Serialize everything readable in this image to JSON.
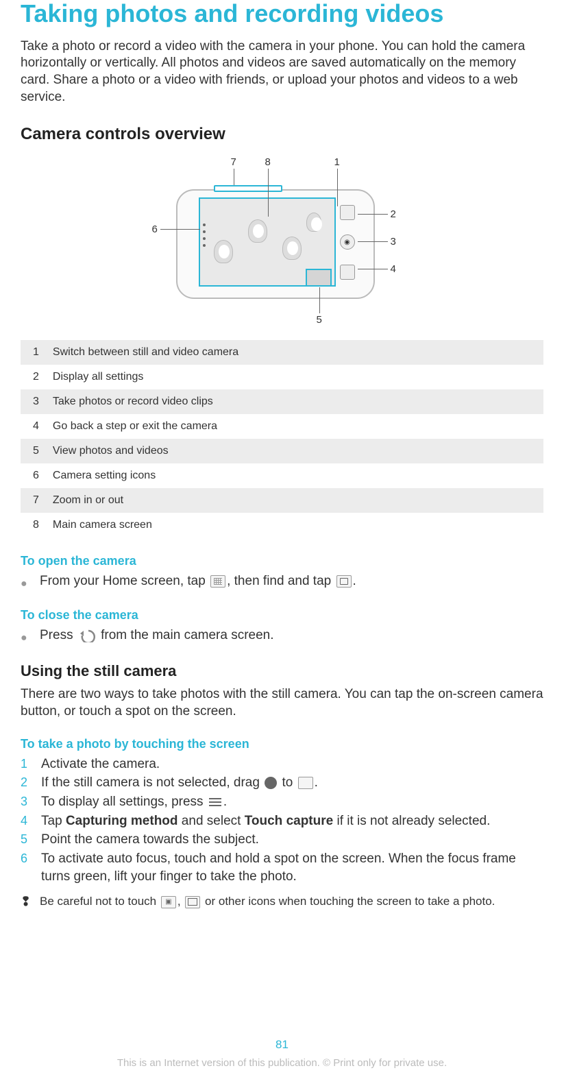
{
  "title": "Taking photos and recording videos",
  "intro": "Take a photo or record a video with the camera in your phone. You can hold the camera horizontally or vertically. All photos and videos are saved automatically on the memory card. Share a photo or a video with friends, or upload your photos and videos to a web service.",
  "section_controls": "Camera controls overview",
  "callouts": {
    "c1": "1",
    "c2": "2",
    "c3": "3",
    "c4": "4",
    "c5": "5",
    "c6": "6",
    "c7": "7",
    "c8": "8"
  },
  "legend": [
    {
      "n": "1",
      "t": "Switch between still and video camera"
    },
    {
      "n": "2",
      "t": "Display all settings"
    },
    {
      "n": "3",
      "t": "Take photos or record video clips"
    },
    {
      "n": "4",
      "t": "Go back a step or exit the camera"
    },
    {
      "n": "5",
      "t": "View photos and videos"
    },
    {
      "n": "6",
      "t": "Camera setting icons"
    },
    {
      "n": "7",
      "t": "Zoom in or out"
    },
    {
      "n": "8",
      "t": "Main camera screen"
    }
  ],
  "open_heading": "To open the camera",
  "open_step_pre": "From your Home screen, tap ",
  "open_step_mid": ", then find and tap ",
  "open_step_post": ".",
  "close_heading": "To close the camera",
  "close_step_pre": "Press ",
  "close_step_post": " from the main camera screen.",
  "still_heading": "Using the still camera",
  "still_para": "There are two ways to take photos with the still camera. You can tap the on-screen camera button, or touch a spot on the screen.",
  "touch_heading": "To take a photo by touching the screen",
  "steps": {
    "s1": "Activate the camera.",
    "s2_pre": "If the still camera is not selected, drag ",
    "s2_mid": " to ",
    "s2_post": ".",
    "s3_pre": "To display all settings, press ",
    "s3_post": ".",
    "s4_pre": "Tap ",
    "s4_b1": "Capturing method",
    "s4_mid": " and select ",
    "s4_b2": "Touch capture",
    "s4_post": " if it is not already selected.",
    "s5": "Point the camera towards the subject.",
    "s6": "To activate auto focus, touch and hold a spot on the screen. When the focus frame turns green, lift your finger to take the photo."
  },
  "step_nums": {
    "n1": "1",
    "n2": "2",
    "n3": "3",
    "n4": "4",
    "n5": "5",
    "n6": "6"
  },
  "warning_pre": "Be careful not to touch ",
  "warning_mid": ", ",
  "warning_post": " or other icons when touching the screen to take a photo.",
  "page_number": "81",
  "footer_note": "This is an Internet version of this publication. © Print only for private use."
}
